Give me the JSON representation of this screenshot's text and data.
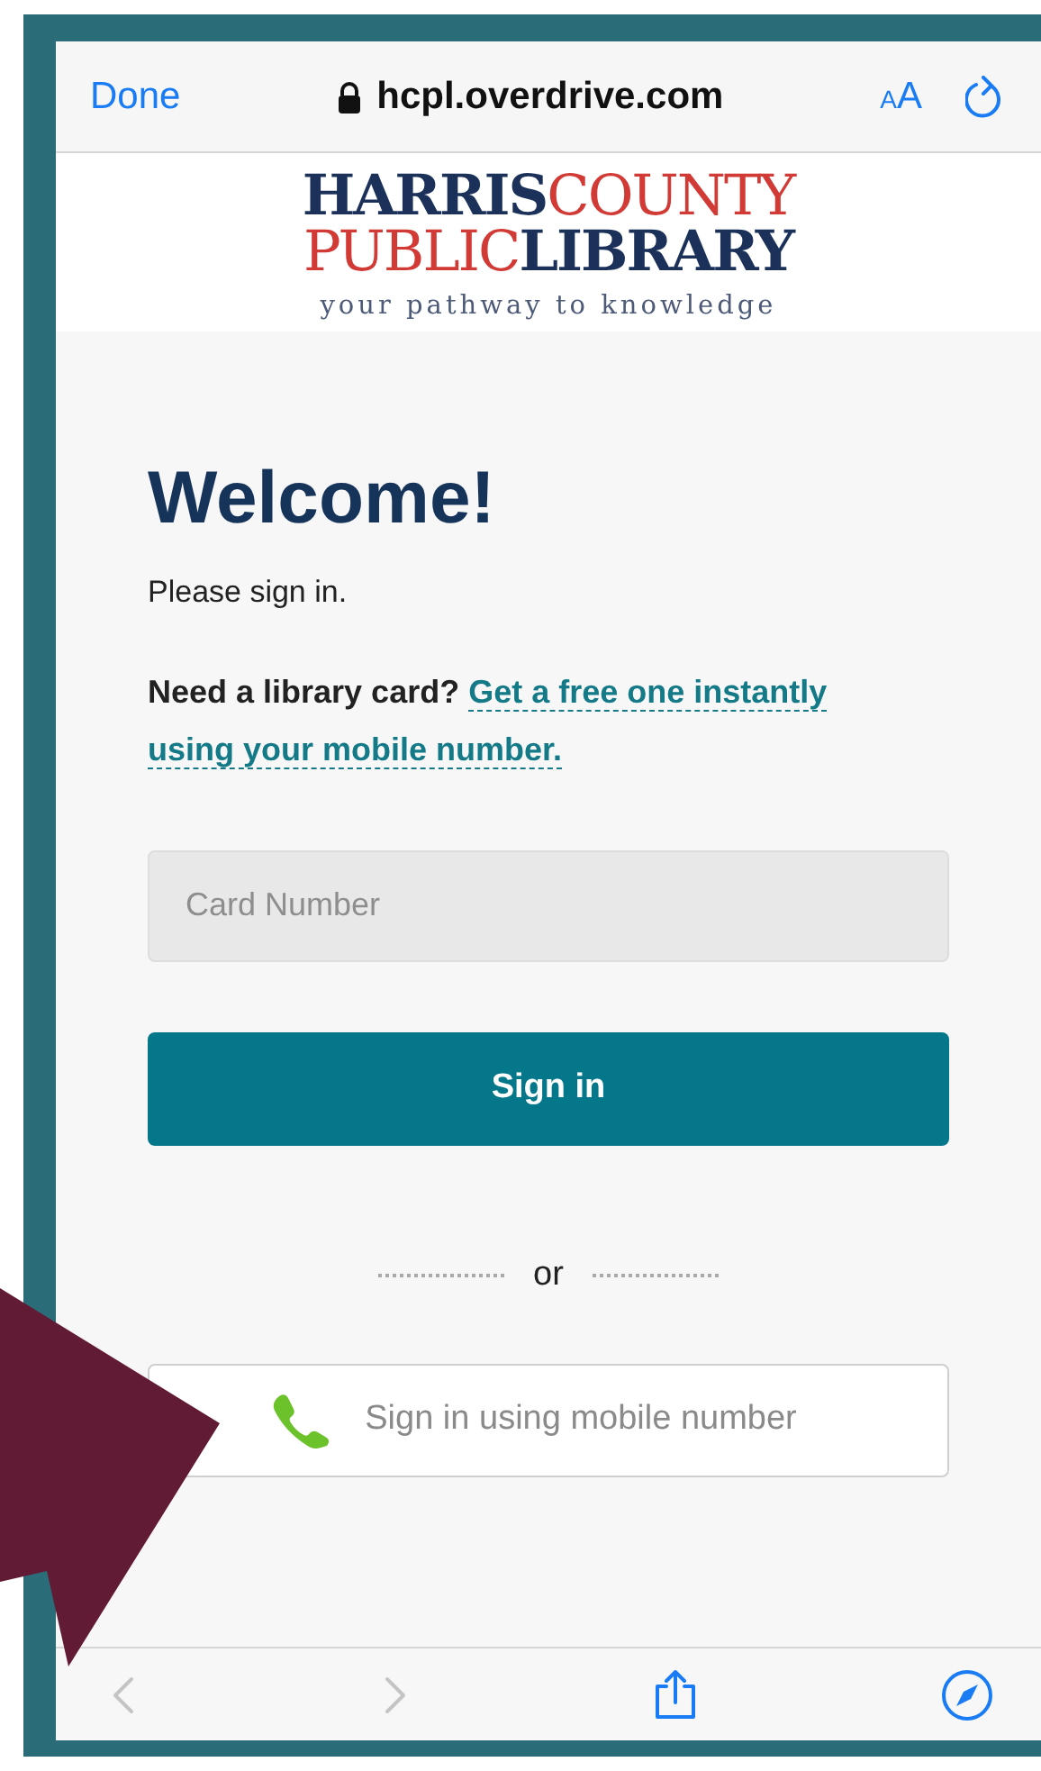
{
  "browser": {
    "done": "Done",
    "url": "hcpl.overdrive.com",
    "text_size": "AA"
  },
  "logo": {
    "lines": [
      "**HARRIS**COUNTY",
      "PUBLIC**LIBRARY**"
    ],
    "tagline": "your pathway to knowledge"
  },
  "sign_in": {
    "title": "Welcome!",
    "subtitle": "Please sign in.",
    "card_prompt": "Need a library card?",
    "card_link": [
      "Get a free one instantly",
      "using your mobile number."
    ],
    "card_field": {
      "placeholder": "Card Number"
    },
    "submit": "Sign in",
    "divider": "or",
    "mobile_button": "Sign in using mobile number"
  },
  "toolbar": [
    {
      "kind": "back",
      "disabled": true
    },
    {
      "kind": "forward",
      "disabled": true
    },
    {
      "kind": "share",
      "disabled": false
    },
    {
      "kind": "compass",
      "disabled": false
    }
  ]
}
